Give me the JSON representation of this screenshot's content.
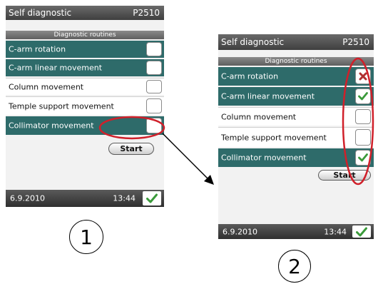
{
  "screen1": {
    "title": "Self diagnostic",
    "code": "P2510",
    "section": "Diagnostic routines",
    "rows": [
      {
        "label": "C-arm rotation",
        "selected": true,
        "result": "none"
      },
      {
        "label": "C-arm linear movement",
        "selected": true,
        "result": "none"
      },
      {
        "label": "Column movement",
        "selected": false,
        "result": "none"
      },
      {
        "label": "Temple support movement",
        "selected": false,
        "result": "none"
      },
      {
        "label": "Collimator movement",
        "selected": true,
        "result": "none"
      }
    ],
    "start_label": "Start",
    "date": "6.9.2010",
    "time": "13:44",
    "ok_icon": "checkmark-icon"
  },
  "screen2": {
    "title": "Self diagnostic",
    "code": "P2510",
    "section": "Diagnostic routines",
    "rows": [
      {
        "label": "C-arm rotation",
        "selected": true,
        "result": "fail"
      },
      {
        "label": "C-arm linear movement",
        "selected": true,
        "result": "pass"
      },
      {
        "label": "Column movement",
        "selected": false,
        "result": "none"
      },
      {
        "label": "Temple support movement",
        "selected": false,
        "result": "none"
      },
      {
        "label": "Collimator movement",
        "selected": true,
        "result": "pass"
      }
    ],
    "start_label": "Start",
    "date": "6.9.2010",
    "time": "13:44",
    "ok_icon": "checkmark-icon"
  },
  "step_labels": [
    "1",
    "2"
  ],
  "colors": {
    "row_selected": "#2e6b6a",
    "pass": "#3a9a3a",
    "fail": "#b03030",
    "highlight": "#d0202a"
  }
}
